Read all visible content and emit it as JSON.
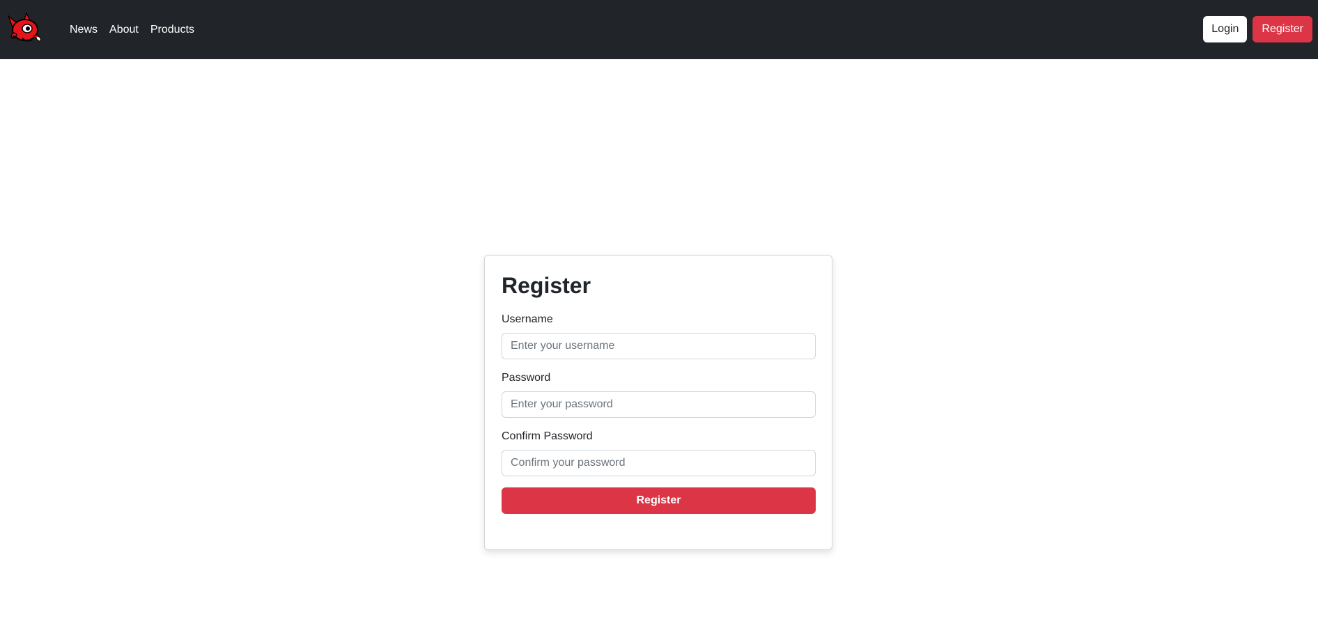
{
  "colors": {
    "navbar_bg": "#212529",
    "accent": "#dc3545",
    "text": "#212529",
    "placeholder": "#6c757d",
    "border": "#ced4da"
  },
  "navbar": {
    "logo_icon": "red-fox-mascot-logo",
    "links": [
      {
        "label": "News"
      },
      {
        "label": "About"
      },
      {
        "label": "Products"
      }
    ],
    "login_label": "Login",
    "register_label": "Register"
  },
  "form": {
    "title": "Register",
    "username": {
      "label": "Username",
      "value": "",
      "placeholder": "Enter your username"
    },
    "password": {
      "label": "Password",
      "value": "",
      "placeholder": "Enter your password"
    },
    "confirm_password": {
      "label": "Confirm Password",
      "value": "",
      "placeholder": "Confirm your password"
    },
    "submit_label": "Register"
  }
}
